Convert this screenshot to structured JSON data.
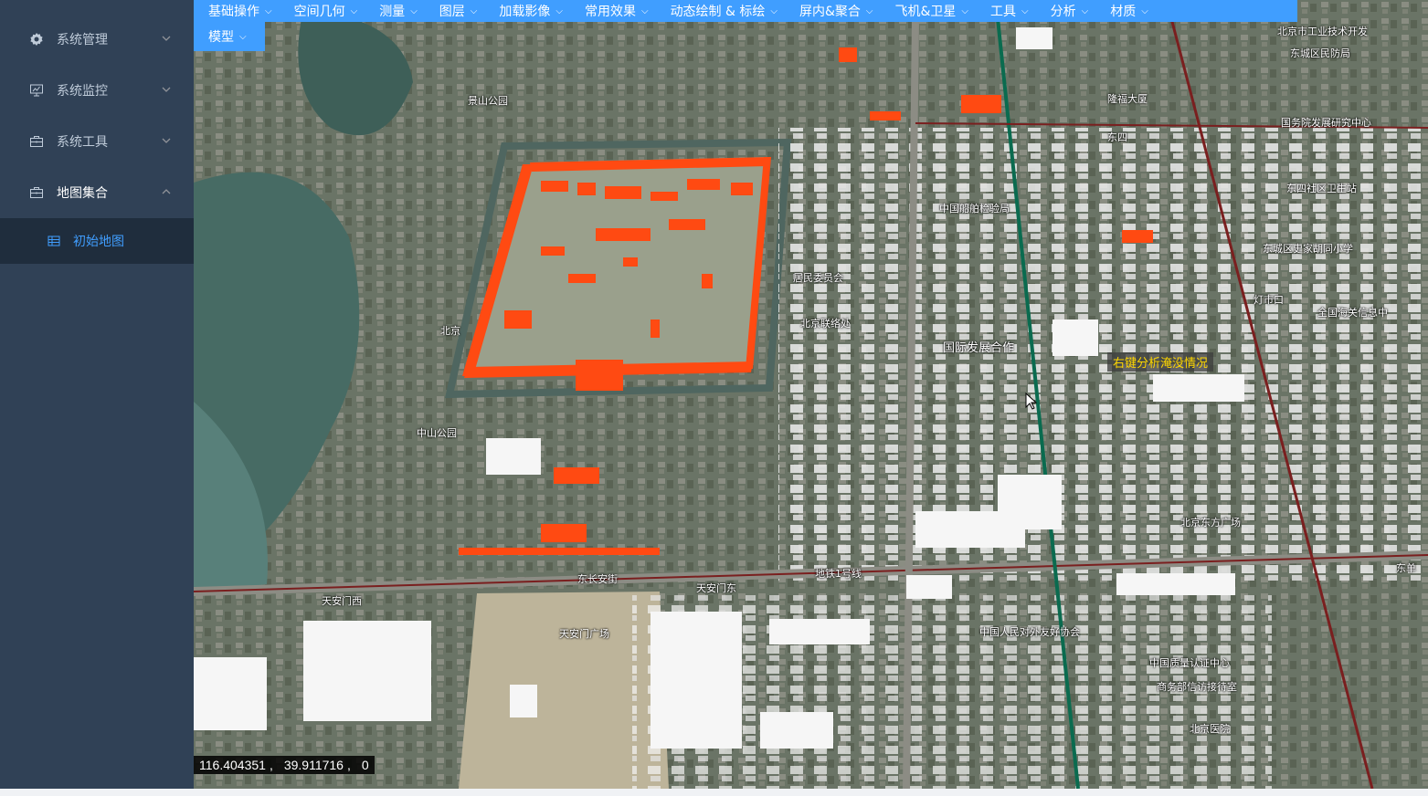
{
  "sidebar": {
    "items": [
      {
        "label": "系统管理",
        "icon": "gear-icon"
      },
      {
        "label": "系统监控",
        "icon": "monitor-icon"
      },
      {
        "label": "系统工具",
        "icon": "toolbox-icon"
      },
      {
        "label": "地图集合",
        "icon": "toolbox-icon"
      }
    ],
    "submenu": [
      {
        "label": "初始地图",
        "icon": "table-icon"
      }
    ]
  },
  "toolbar": {
    "row1": [
      "基础操作",
      "空间几何",
      "测量",
      "图层",
      "加载影像",
      "常用效果",
      "动态绘制 & 标绘",
      "屏内&聚合",
      "飞机&卫星",
      "工具",
      "分析",
      "材质"
    ],
    "row2": [
      "模型"
    ]
  },
  "map": {
    "tooltip": "右键分析淹没情况",
    "coords": {
      "lon": "116.404351",
      "lat": "39.911716",
      "alt": "0"
    },
    "labels": [
      "东长安街",
      "地铁1号线",
      "天安门东",
      "天安门西",
      "天安门广场",
      "国际发展合作",
      "中国船舶检验局",
      "东四",
      "东城区史家胡同小学",
      "全国海关信息中",
      "北京东方广场",
      "中国人民对外友好协会",
      "中国质量认证中心",
      "商务部信访接待室",
      "北京医院",
      "国务院发展研究中心",
      "东四社区卫生站",
      "北京市工业技术开发",
      "东城区民防局",
      "隆福大厦",
      "灯市口",
      "东单",
      "景山公园",
      "北京",
      "中山公园",
      "居民委员会",
      "北京联络处"
    ],
    "colors": {
      "highlight": "#ff4a12",
      "building": "#ffffff",
      "subway_green": "#0a6b4f",
      "road_red": "#7a1f1f"
    }
  }
}
